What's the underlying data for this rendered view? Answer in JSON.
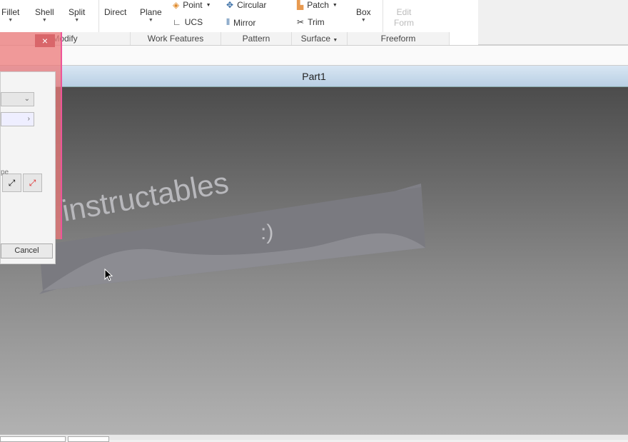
{
  "ribbon": {
    "modify": {
      "fillet": "Fillet",
      "shell": "Shell",
      "split": "Split",
      "direct": "Direct",
      "group": "Modify"
    },
    "work_features": {
      "plane": "Plane",
      "point": "Point",
      "ucs": "UCS",
      "group": "Work Features"
    },
    "pattern": {
      "circular": "Circular",
      "mirror": "Mirror",
      "group": "Pattern"
    },
    "surface": {
      "patch": "Patch",
      "trim": "Trim",
      "group": "Surface"
    },
    "freeform": {
      "box": "Box",
      "edit_form_1": "Edit",
      "edit_form_2": "Form",
      "group": "Freeform"
    }
  },
  "document": {
    "title": "Part1"
  },
  "model": {
    "text": "instructables",
    "smiley": ":)"
  },
  "dialog": {
    "close": "×",
    "partial_label": "pe",
    "cancel": "Cancel"
  }
}
